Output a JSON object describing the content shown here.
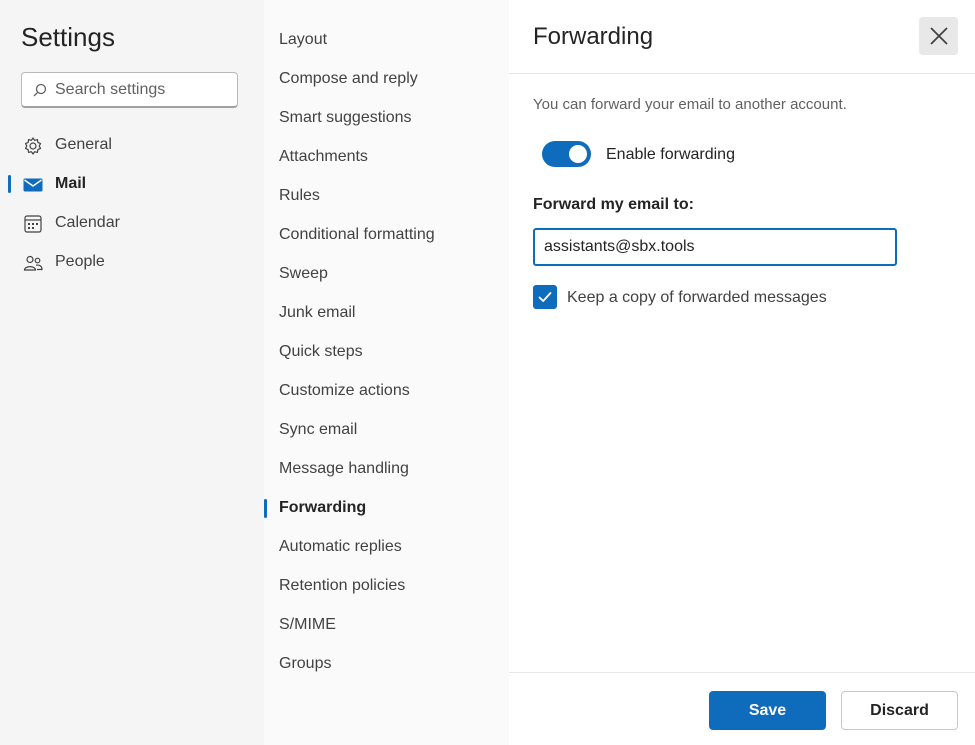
{
  "settings": {
    "title": "Settings",
    "search_placeholder": "Search settings"
  },
  "categories": [
    {
      "label": "General",
      "icon": "gear-icon",
      "selected": false
    },
    {
      "label": "Mail",
      "icon": "mail-icon",
      "selected": true
    },
    {
      "label": "Calendar",
      "icon": "calendar-icon",
      "selected": false
    },
    {
      "label": "People",
      "icon": "people-icon",
      "selected": false
    }
  ],
  "mail_sections": [
    {
      "label": "Layout"
    },
    {
      "label": "Compose and reply"
    },
    {
      "label": "Smart suggestions"
    },
    {
      "label": "Attachments"
    },
    {
      "label": "Rules"
    },
    {
      "label": "Conditional formatting"
    },
    {
      "label": "Sweep"
    },
    {
      "label": "Junk email"
    },
    {
      "label": "Quick steps"
    },
    {
      "label": "Customize actions"
    },
    {
      "label": "Sync email"
    },
    {
      "label": "Message handling"
    },
    {
      "label": "Forwarding",
      "selected": true
    },
    {
      "label": "Automatic replies"
    },
    {
      "label": "Retention policies"
    },
    {
      "label": "S/MIME"
    },
    {
      "label": "Groups"
    }
  ],
  "panel": {
    "title": "Forwarding",
    "description": "You can forward your email to another account.",
    "enable_forwarding": {
      "label": "Enable forwarding",
      "on": true
    },
    "forward_to_label": "Forward my email to:",
    "forward_to_value": "assistants@sbx.tools",
    "keep_copy": {
      "label": "Keep a copy of forwarded messages",
      "checked": true
    },
    "save_label": "Save",
    "discard_label": "Discard"
  },
  "colors": {
    "accent": "#0f6cbd",
    "left_bg": "#f5f5f5",
    "middle_bg": "#fafafa",
    "panel_bg": "#ffffff"
  }
}
